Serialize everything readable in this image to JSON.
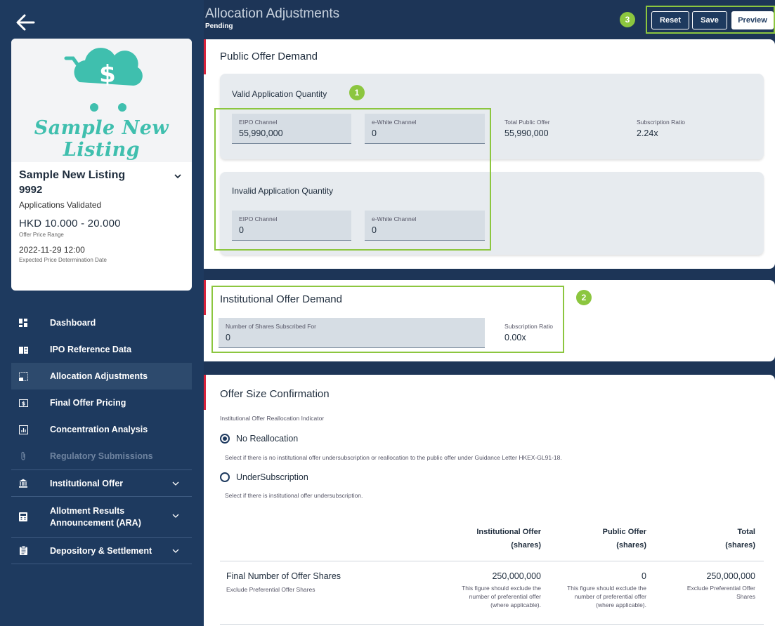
{
  "header": {
    "title": "Allocation Adjustments",
    "status": "Pending",
    "badge3": "3",
    "buttons": {
      "reset": "Reset",
      "save": "Save",
      "preview": "Preview"
    }
  },
  "listing": {
    "logo_text": "Sample New Listing",
    "name": "Sample New Listing",
    "code": "9992",
    "status": "Applications Validated",
    "price_range": "HKD 10.000 - 20.000",
    "price_range_label": "Offer Price Range",
    "date": "2022-11-29 12:00",
    "date_label": "Expected Price Determination Date"
  },
  "nav": [
    {
      "label": "Dashboard",
      "icon": "dashboard-icon"
    },
    {
      "label": "IPO Reference Data",
      "icon": "book-icon"
    },
    {
      "label": "Allocation Adjustments",
      "icon": "allocation-icon",
      "active": true
    },
    {
      "label": "Final Offer Pricing",
      "icon": "dollar-icon"
    },
    {
      "label": "Concentration Analysis",
      "icon": "chart-icon"
    },
    {
      "label": "Regulatory Submissions",
      "icon": "paperclip-icon",
      "disabled": true
    },
    {
      "label": "Institutional Offer",
      "icon": "bank-icon"
    },
    {
      "label": "Allotment Results Announcement (ARA)",
      "label_line1": "Allotment Results",
      "label_line2": "Announcement (ARA)",
      "icon": "calculator-icon"
    },
    {
      "label": "Depository & Settlement",
      "icon": "clipboard-icon"
    }
  ],
  "public_offer": {
    "title": "Public Offer Demand",
    "badge": "1",
    "valid": {
      "title": "Valid Application Quantity",
      "eipo_label": "EIPO Channel",
      "eipo_value": "55,990,000",
      "white_label": "e-White Channel",
      "white_value": "0",
      "total_label": "Total Public Offer",
      "total_value": "55,990,000",
      "ratio_label": "Subscription Ratio",
      "ratio_value": "2.24x"
    },
    "invalid": {
      "title": "Invalid Application Quantity",
      "eipo_label": "EIPO Channel",
      "eipo_value": "0",
      "white_label": "e-White Channel",
      "white_value": "0"
    }
  },
  "institutional": {
    "title": "Institutional Offer Demand",
    "badge": "2",
    "shares_label": "Number of Shares Subscribed For",
    "shares_value": "0",
    "ratio_label": "Subscription Ratio",
    "ratio_value": "0.00x"
  },
  "offer_size": {
    "title": "Offer Size Confirmation",
    "indicator_label": "Institutional Offer Reallocation Indicator",
    "opt1_label": "No Reallocation",
    "opt1_desc": "Select if there is no institutional offer undersubscription or reallocation to the public offer under Guidance Letter HKEX-GL91-18.",
    "opt2_label": "UnderSubscription",
    "opt2_desc": "Select if there is institutional offer undersubscription.",
    "table": {
      "headers": [
        {
          "line1": "Institutional Offer",
          "line2": "(shares)"
        },
        {
          "line1": "Public Offer",
          "line2": "(shares)"
        },
        {
          "line1": "Total",
          "line2": "(shares)"
        }
      ],
      "row": {
        "label": "Final Number of Offer Shares",
        "sublabel": "Exclude Preferential Offer Shares",
        "values": [
          "250,000,000",
          "0",
          "250,000,000"
        ],
        "note1_l1": "This figure should exclude the",
        "note1_l2": "number of preferential offer",
        "note1_l3": "(where applicable).",
        "note2_l1": "This figure should exclude the",
        "note2_l2": "number of preferential offer",
        "note2_l3": "(where applicable).",
        "note3_l1": "Exclude Preferential Offer",
        "note3_l2": "Shares"
      }
    }
  }
}
